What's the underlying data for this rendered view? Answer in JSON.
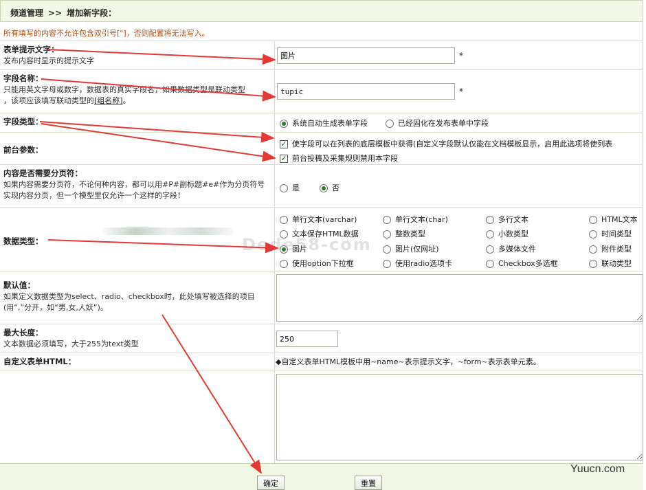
{
  "breadcrumb": {
    "section": "频道管理",
    "sep": ">>",
    "current": "增加新字段："
  },
  "notice": "所有填写的内容不允许包含双引号[\"]，否则配置将无法写入。",
  "form_label": {
    "title": "表单提示文字：",
    "desc": "发布内容时显示的提示文字",
    "value": "图片",
    "required": "*"
  },
  "field_name": {
    "title": "字段名称：",
    "desc1": "只能用英文字母或数字，数据表的真实字段名，如果数据类型是联动类型",
    "desc2": "，该项应该填写联动类型的",
    "link": "[组名称]",
    "desc3": "。",
    "value": "tupic",
    "required": "*"
  },
  "field_kind": {
    "title": "字段类型：",
    "options": [
      "系统自动生成表单字段",
      "已经固化在发布表单中字段"
    ],
    "selected": 0
  },
  "front_params": {
    "title": "前台参数：",
    "check1": "使字段可以在列表的底层模板中获得(自定义字段默认仅能在文档模板显示，启用此选项将使列表",
    "check2": "前台投稿及采集规则禁用本字段",
    "check1_on": true,
    "check2_on": true
  },
  "paging": {
    "title": "内容是否需要分页符：",
    "desc": "如果内容需要分页符，不论何种内容，都可以用#P#副标题#e#作为分页符号实现内容分页，但一个模型里仅允许一个这样的字段！",
    "options": [
      "是",
      "否"
    ],
    "selected": 1
  },
  "data_type": {
    "title": "数据类型：",
    "options": [
      [
        "单行文本(varchar)",
        "单行文本(char)",
        "多行文本",
        "HTML文本"
      ],
      [
        "文本保存HTML数据",
        "整数类型",
        "小数类型",
        "时间类型"
      ],
      [
        "图片",
        "图片(仅网址)",
        "多媒体文件",
        "附件类型"
      ],
      [
        "使用option下拉框",
        "使用radio选项卡",
        "Checkbox多选框",
        "联动类型"
      ]
    ],
    "selected": "图片"
  },
  "default_value": {
    "title": "默认值：",
    "desc1": "如果定义数据类型为select、radio、checkbox时，此处填写被选择的项目",
    "desc2": "(用“,”分开，如“男,女,人妖”)。",
    "value": ""
  },
  "max_length": {
    "title": "最大长度：",
    "desc": "文本数据必须填写，大于255为text类型",
    "value": "250"
  },
  "custom_html": {
    "title": "自定义表单HTML：",
    "hint": "◆自定义表单HTML模板中用~name~表示提示文字，~form~表示表单元素。",
    "value": ""
  },
  "buttons": {
    "submit": "确定",
    "reset": "重置"
  },
  "watermark": "Dede58-com",
  "brand": "Yuucn.com",
  "colors": {
    "header_bg": "#f3f7e6",
    "notice": "#b64b12",
    "arrow": "#e53935",
    "border": "#d6dfc8"
  }
}
